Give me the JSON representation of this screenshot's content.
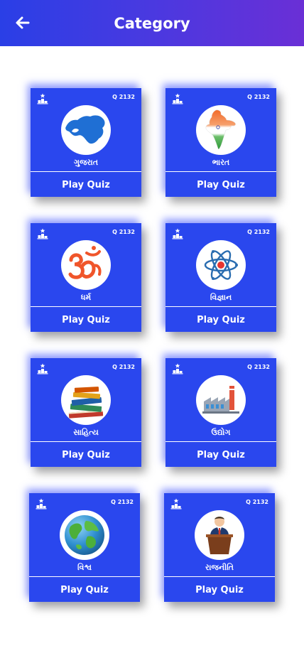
{
  "header": {
    "title": "Category",
    "back_icon": "arrow-left-icon"
  },
  "colors": {
    "appbar_start": "#2a3fe6",
    "appbar_end": "#6a2fd6",
    "card": "#2a47ee",
    "text": "#ffffff"
  },
  "categories": [
    {
      "name": "ગુજરાત",
      "question_count": "Q 2132",
      "action_label": "Play Quiz",
      "icon": "gujarat-map-icon"
    },
    {
      "name": "ભારત",
      "question_count": "Q 2132",
      "action_label": "Play Quiz",
      "icon": "india-map-icon"
    },
    {
      "name": "ધર્મ",
      "question_count": "Q 2132",
      "action_label": "Play Quiz",
      "icon": "om-icon"
    },
    {
      "name": "વિજ્ઞાન",
      "question_count": "Q 2132",
      "action_label": "Play Quiz",
      "icon": "atom-icon"
    },
    {
      "name": "સાહિત્ય",
      "question_count": "Q 2132",
      "action_label": "Play Quiz",
      "icon": "books-icon"
    },
    {
      "name": "ઉદ્યોગ",
      "question_count": "Q 2132",
      "action_label": "Play Quiz",
      "icon": "factory-icon"
    },
    {
      "name": "વિશ્વ",
      "question_count": "Q 2132",
      "action_label": "Play Quiz",
      "icon": "globe-icon"
    },
    {
      "name": "રાજનીતિ",
      "question_count": "Q 2132",
      "action_label": "Play Quiz",
      "icon": "politician-podium-icon"
    }
  ]
}
